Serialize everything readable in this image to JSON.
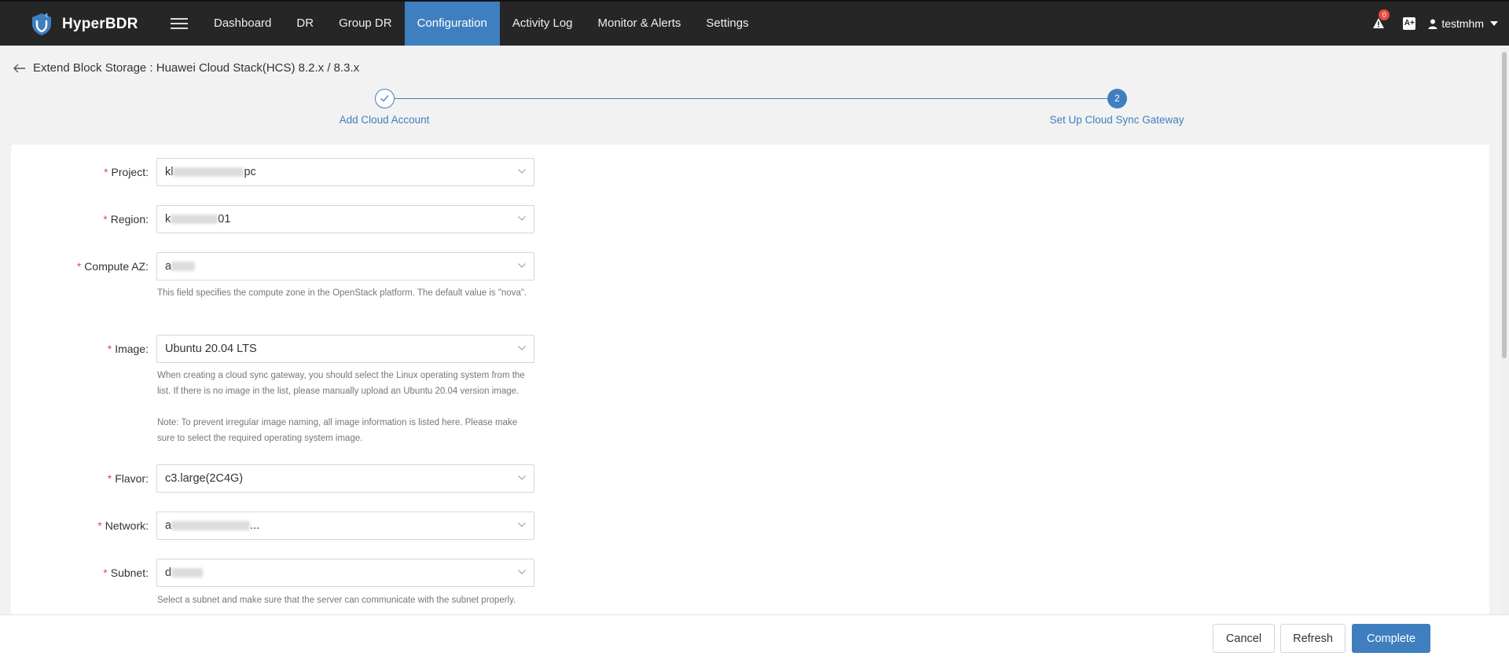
{
  "app": {
    "name": "HyperBDR"
  },
  "nav": {
    "items": [
      {
        "label": "Dashboard"
      },
      {
        "label": "DR"
      },
      {
        "label": "Group DR"
      },
      {
        "label": "Configuration"
      },
      {
        "label": "Activity Log"
      },
      {
        "label": "Monitor & Alerts"
      },
      {
        "label": "Settings"
      }
    ],
    "active": "Configuration"
  },
  "header_right": {
    "alert_count": "0",
    "language_icon": "A+",
    "username": "testmhm"
  },
  "page": {
    "title": "Extend Block Storage : Huawei Cloud Stack(HCS) 8.2.x / 8.3.x"
  },
  "steps": [
    {
      "label": "Add Cloud Account",
      "status": "done"
    },
    {
      "label": "Set Up Cloud Sync Gateway",
      "number": "2",
      "status": "active"
    }
  ],
  "form": {
    "project": {
      "label": "Project:",
      "value_prefix": "kl",
      "value_suffix": "pc"
    },
    "region": {
      "label": "Region:",
      "value_prefix": "k",
      "value_suffix": "01"
    },
    "compute_az": {
      "label": "Compute AZ:",
      "value_prefix": "a",
      "help": "This field specifies the compute zone in the OpenStack platform. The default value is \"nova\"."
    },
    "image": {
      "label": "Image:",
      "value": "Ubuntu 20.04 LTS",
      "help": "When creating a cloud sync gateway, you should select the Linux operating system from the list. If there is no image in the list, please manually upload an Ubuntu 20.04 version image.",
      "note": "Note: To prevent irregular image naming, all image information is listed here. Please make sure to select the required operating system image."
    },
    "flavor": {
      "label": "Flavor:",
      "value": "c3.large(2C4G)"
    },
    "network": {
      "label": "Network:",
      "value_prefix": "a",
      "value_suffix": "..."
    },
    "subnet": {
      "label": "Subnet:",
      "value_prefix": "d",
      "help": "Select a subnet and make sure that the server can communicate with the subnet properly."
    },
    "required_mark": "*"
  },
  "footer": {
    "cancel_label": "Cancel",
    "refresh_label": "Refresh",
    "complete_label": "Complete"
  },
  "colors": {
    "accent": "#3f7fbf",
    "topbar": "#262626",
    "required": "#e54d42"
  }
}
